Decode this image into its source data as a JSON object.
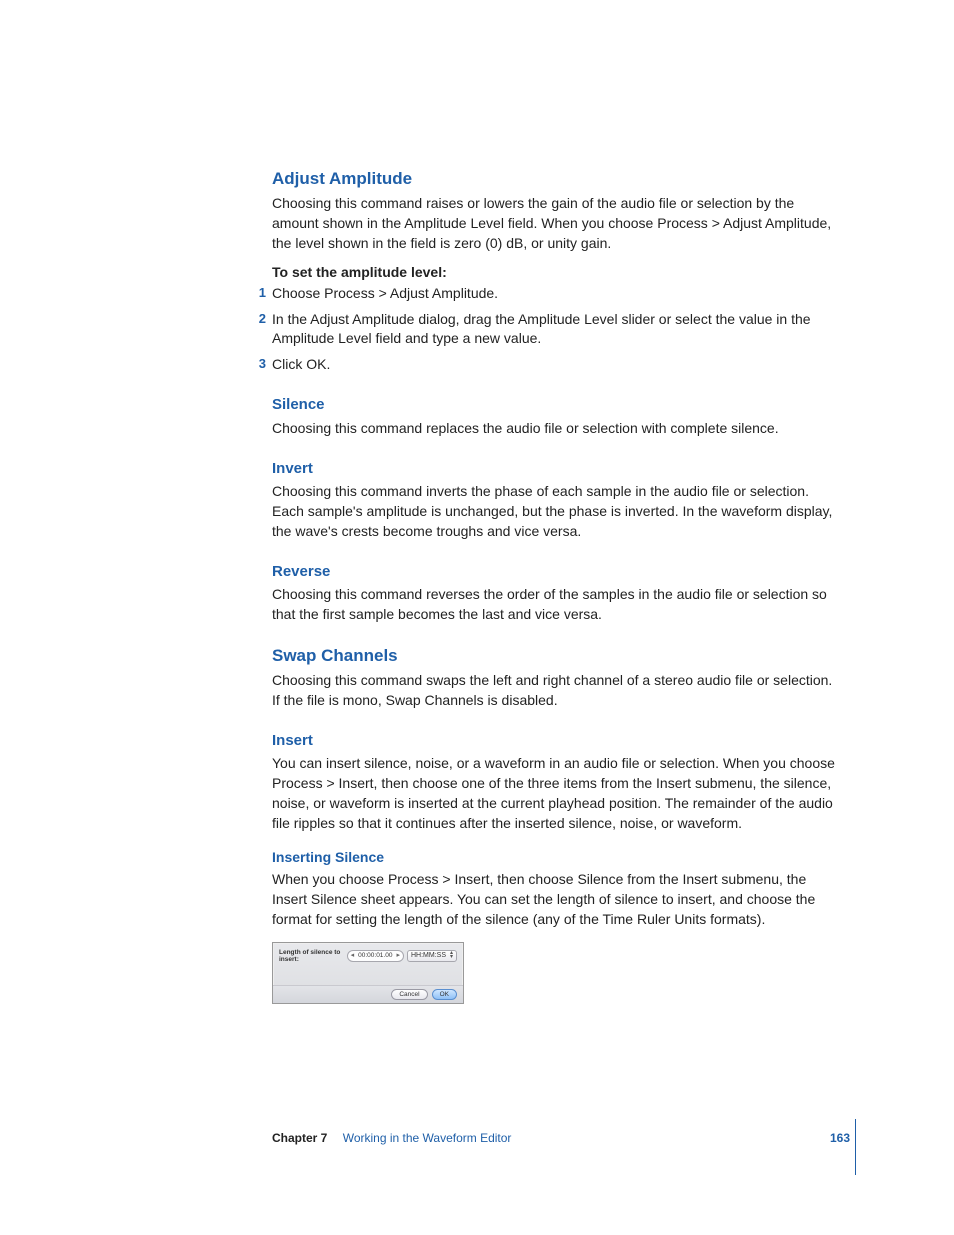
{
  "sections": {
    "adjust_amplitude": {
      "title": "Adjust Amplitude",
      "body": "Choosing this command raises or lowers the gain of the audio file or selection by the amount shown in the Amplitude Level field. When you choose Process > Adjust Amplitude, the level shown in the field is zero (0) dB, or unity gain.",
      "task_heading": "To set the amplitude level:",
      "steps": [
        "Choose Process > Adjust Amplitude.",
        "In the Adjust Amplitude dialog, drag the Amplitude Level slider or select the value in the Amplitude Level field and type a new value.",
        "Click OK."
      ]
    },
    "silence": {
      "title": "Silence",
      "body": "Choosing this command replaces the audio file or selection with complete silence."
    },
    "invert": {
      "title": "Invert",
      "body": "Choosing this command inverts the phase of each sample in the audio file or selection. Each sample's amplitude is unchanged, but the phase is inverted. In the waveform display, the wave's crests become troughs and vice versa."
    },
    "reverse": {
      "title": "Reverse",
      "body": "Choosing this command reverses the order of the samples in the audio file or selection so that the first sample becomes the last and vice versa."
    },
    "swap_channels": {
      "title": "Swap Channels",
      "body": "Choosing this command swaps the left and right channel of a stereo audio file or selection. If the file is mono, Swap Channels is disabled."
    },
    "insert": {
      "title": "Insert",
      "body": "You can insert silence, noise, or a waveform in an audio file or selection. When you choose Process > Insert, then choose one of the three items from the Insert submenu, the silence, noise, or waveform is inserted at the current playhead position. The remainder of the audio file ripples so that it continues after the inserted silence, noise, or waveform.",
      "sub_title": "Inserting Silence",
      "sub_body": "When you choose Process > Insert, then choose Silence from the Insert submenu, the Insert Silence sheet appears. You can set the length of silence to insert, and choose the format for setting the length of the silence (any of the Time Ruler Units formats)."
    }
  },
  "dialog": {
    "label": "Length of silence to insert:",
    "value": "00:00:01.00",
    "format": "HH:MM:SS",
    "cancel": "Cancel",
    "ok": "OK"
  },
  "footer": {
    "chapter_label": "Chapter 7",
    "chapter_title": "Working in the Waveform Editor",
    "page": "163"
  }
}
